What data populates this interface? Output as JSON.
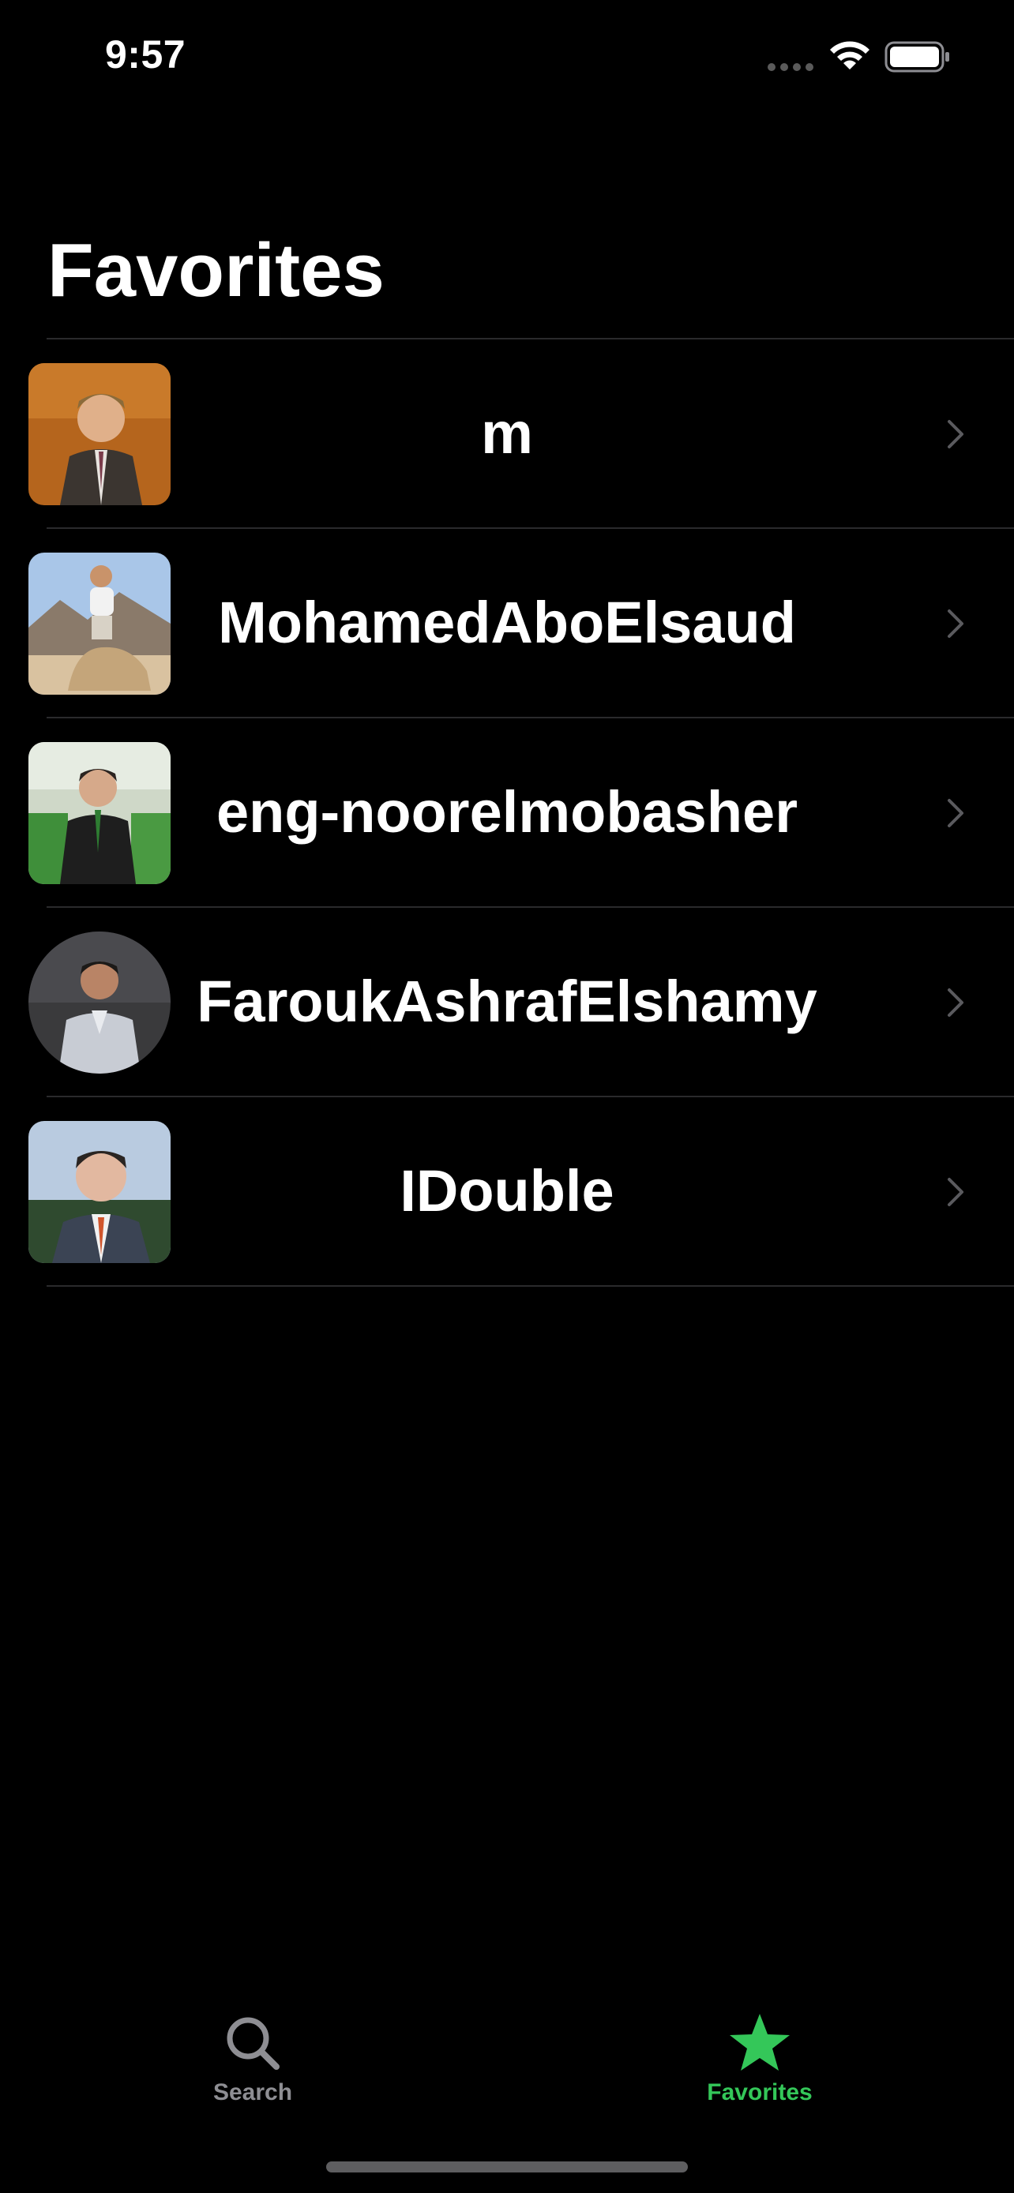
{
  "status_bar": {
    "time": "9:57",
    "wifi_icon": "wifi-icon",
    "battery_icon": "battery-icon",
    "signal_icon": "signal-dots-icon"
  },
  "header": {
    "title": "Favorites"
  },
  "favorites": [
    {
      "name": "m",
      "avatar": "avatar-photo",
      "chevron": "chevron-right-icon"
    },
    {
      "name": "MohamedAboElsaud",
      "avatar": "avatar-photo",
      "chevron": "chevron-right-icon"
    },
    {
      "name": "eng-noorelmobasher",
      "avatar": "avatar-photo",
      "chevron": "chevron-right-icon"
    },
    {
      "name": "FaroukAshrafElshamy",
      "avatar": "avatar-photo",
      "chevron": "chevron-right-icon"
    },
    {
      "name": "IDouble",
      "avatar": "avatar-photo",
      "chevron": "chevron-right-icon"
    }
  ],
  "tab_bar": {
    "tabs": [
      {
        "label": "Search",
        "icon": "magnifying-glass-icon",
        "selected": false
      },
      {
        "label": "Favorites",
        "icon": "star-icon",
        "selected": true
      }
    ]
  },
  "colors": {
    "background": "#000000",
    "text": "#ffffff",
    "accent": "#34c759",
    "inactive_tab": "#8e8e93",
    "separator": "#2a2a2c",
    "chevron": "#5a5a5e"
  }
}
